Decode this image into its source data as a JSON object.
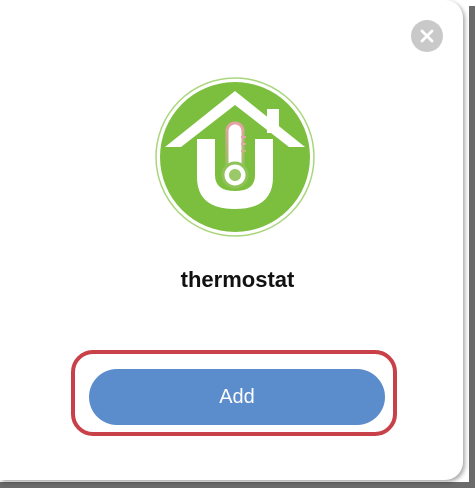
{
  "dialog": {
    "device_name": "thermostat",
    "device_icon": "thermostat-house-icon",
    "add_label": "Add",
    "close_icon": "close-icon"
  },
  "colors": {
    "icon_green": "#7cbf3f",
    "button_blue": "#5b8ccb",
    "highlight_red": "#c84048",
    "close_gray": "#c9c9c9"
  }
}
